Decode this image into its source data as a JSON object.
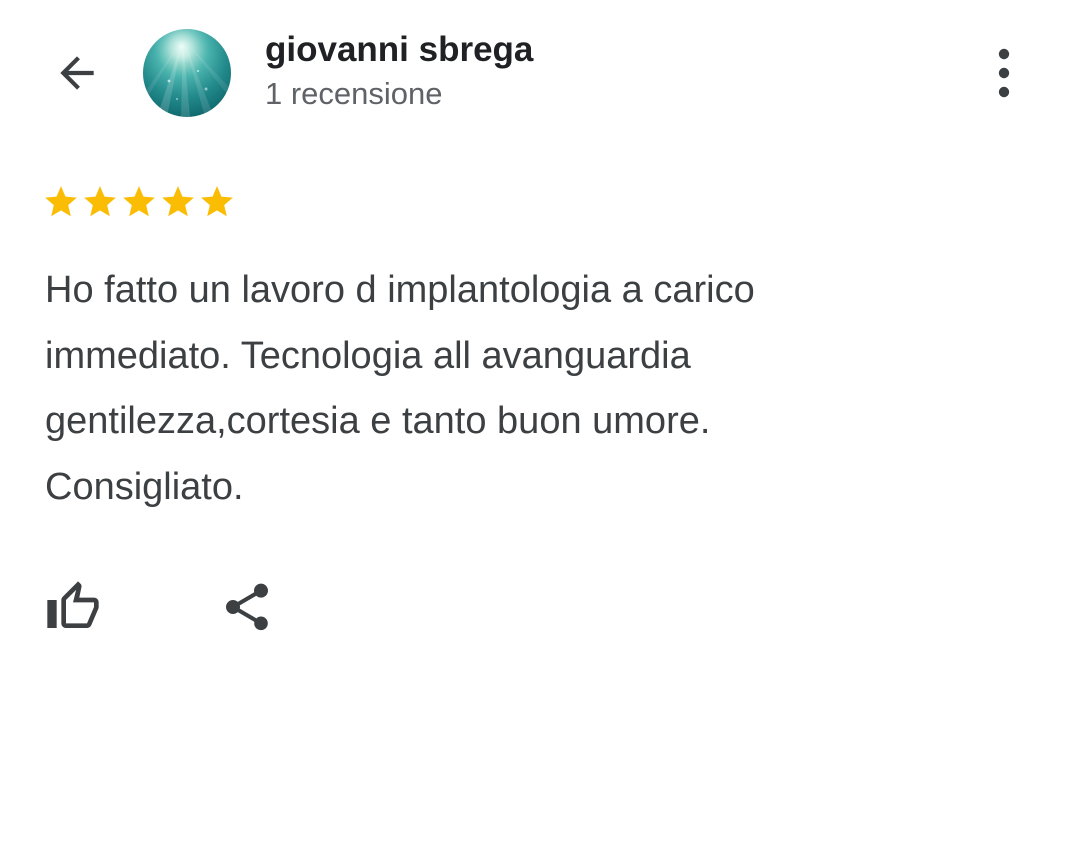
{
  "header": {
    "back_icon": "arrow-back-icon",
    "avatar_icon": "profile-photo",
    "author_name": "giovanni sbrega",
    "review_count": "1 recensione",
    "more_icon": "more-vert-icon"
  },
  "review": {
    "rating": 5,
    "rating_max": 5,
    "star_color": "#fbbc04",
    "text": "Ho fatto un lavoro d implantologia a carico\nimmediato. Tecnologia all avanguardia\ngentilezza,cortesia e tanto buon umore.\nConsigliato."
  },
  "actions": {
    "like_icon": "thumb-up-icon",
    "share_icon": "share-icon"
  },
  "colors": {
    "primary_text": "#202124",
    "secondary_text": "#5f6368",
    "body_text": "#3c4043",
    "icon": "#3c4043",
    "background": "#ffffff"
  }
}
